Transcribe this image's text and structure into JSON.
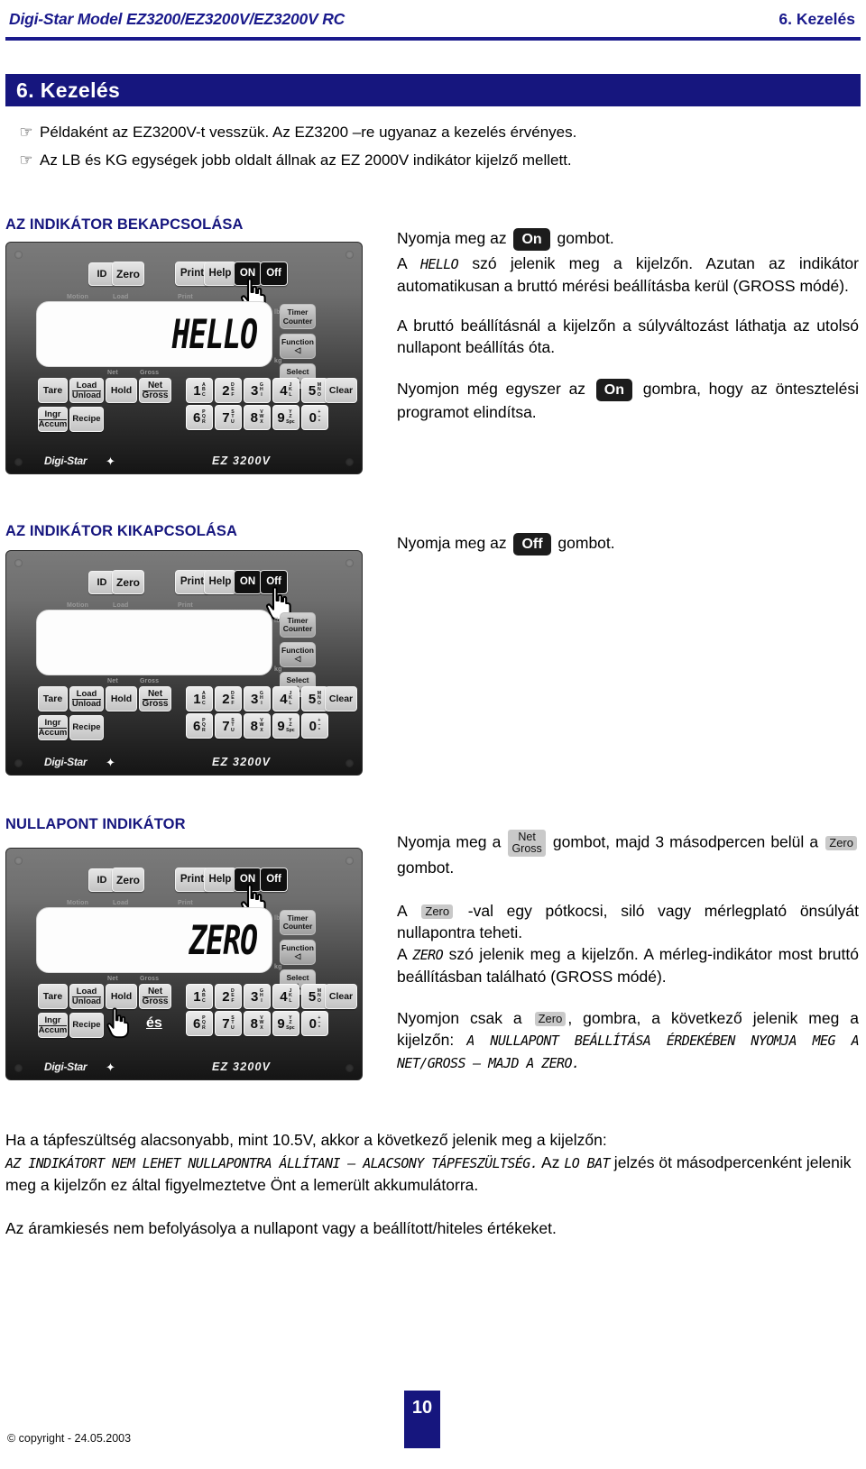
{
  "header": {
    "left": "Digi-Star Model EZ3200/EZ3200V/EZ3200V RC",
    "right": "6. Kezelés"
  },
  "chapter": {
    "title": "6. Kezelés"
  },
  "notes": [
    {
      "icon": "pointing-hand-icon",
      "text": "Példaként az EZ3200V-t vesszük. Az EZ3200 –re ugyanaz a kezelés érvényes."
    },
    {
      "icon": "pointing-hand-icon",
      "text": "Az LB és KG egységek jobb oldalt állnak az EZ 2000V indikátor kijelző mellett."
    }
  ],
  "sections": [
    {
      "id": "power-on",
      "heading": "AZ INDIKÁTOR BEKAPCSOLÁSA",
      "display_text": "HELLO",
      "paragraphs": [
        {
          "pre": "Nyomja meg az ",
          "chip": "On",
          "post": " gombot."
        },
        {
          "lcd_word": "HELLO",
          "pre": "A ",
          "post": " szó jelenik meg a kijelzőn. Azutan az indikátor automatikusan a bruttó mérési beállításba kerül (GROSS módé)."
        },
        {
          "plain": "A bruttó beállításnál a kijelzőn a súlyváltozást láthatja az utolsó nullapont beállítás óta."
        },
        {
          "pre": "Nyomjon még egyszer az ",
          "chip": "On",
          "post": " gombra, hogy az öntesztelési programot elindítsa."
        }
      ]
    },
    {
      "id": "power-off",
      "heading": "AZ INDIKÁTOR KIKAPCSOLÁSA",
      "display_text": "",
      "paragraphs": [
        {
          "pre": "Nyomja meg az ",
          "chip": "Off",
          "post": " gombot."
        }
      ]
    },
    {
      "id": "zero-point",
      "heading": "NULLAPONT INDIKÁTOR",
      "display_text": "ZERO",
      "paragraphs": [
        {
          "pre": "Nyomja meg a ",
          "chip2_top": "Net",
          "chip2_bot": "Gross",
          "mid": " gombot, majd 3 másodpercen belül a ",
          "chip": "Zero",
          "post": " gombot."
        },
        {
          "pre": "A ",
          "chip": "Zero",
          "post": " -val egy pótkocsi, siló vagy mérlegplató önsúlyát nullapontra teheti."
        },
        {
          "lcd_word": "ZERO",
          "pre": "A ",
          "post": " szó jelenik meg a kijelzőn. A mérleg-indikátor most bruttó beállításban található (GROSS módé)."
        },
        {
          "pre": "Nyomjon csak a ",
          "chip": "Zero",
          "post": ", gombra, a következő jelenik meg a kijelzőn: ",
          "lcd_tail": "A NULLAPONT BEÁLLÍTÁSA ÉRDEKÉBEN NYOMJA MEG A NET/GROSS – MAJD A ZERO."
        }
      ]
    }
  ],
  "closing": {
    "low_voltage_intro": "Ha a tápfeszültség alacsonyabb, mint 10.5V, akkor a következő jelenik meg a kijelzőn:",
    "low_voltage_lcd": "AZ INDIKÁTORT NEM LEHET NULLAPONTRA ÁLLÍTANI – ALACSONY TÁPFESZÜLTSÉG.",
    "low_voltage_mid": " Az ",
    "low_voltage_code": "LO BAT",
    "low_voltage_tail": " jelzés öt másodpercenként jelenik meg a kijelzőn ez által figyelmeztetve Önt a lemerült akkumulátorra.",
    "power_loss": "Az áramkiesés nem befolyásolya a nullapont vagy a beállított/hiteles értékeket."
  },
  "device": {
    "top_keys": [
      "ID",
      "Zero",
      "Print",
      "Help",
      "ON",
      "Off"
    ],
    "micro_labels": [
      "Motion",
      "Load",
      "Print",
      "Net",
      "Gross",
      "lb",
      "kg"
    ],
    "function_keys": [
      {
        "l1": "Tare",
        "l2": ""
      },
      {
        "l1": "Load",
        "l2": "Unload"
      },
      {
        "l1": "Hold",
        "l2": ""
      },
      {
        "l1": "Net",
        "l2": "Gross"
      },
      {
        "l1": "Ingr",
        "l2": "Accum"
      },
      {
        "l1": "Recipe",
        "l2": ""
      }
    ],
    "right_keys": [
      {
        "l1": "Timer",
        "l2": "Counter"
      },
      {
        "l1": "Function",
        "l2": "◁"
      },
      {
        "l1": "Select",
        "l2": "△"
      }
    ],
    "clear_key": "Clear",
    "numpad": [
      {
        "d": "1",
        "a": "A\nB\nC"
      },
      {
        "d": "2",
        "a": "D\nE\nF"
      },
      {
        "d": "3",
        "a": "G\nH\nI"
      },
      {
        "d": "4",
        "a": "J\nK\nL"
      },
      {
        "d": "5",
        "a": "M\nN\nO"
      },
      {
        "d": "6",
        "a": "P\nQ\nR"
      },
      {
        "d": "7",
        "a": "S\nT\nU"
      },
      {
        "d": "8",
        "a": "V\nW\nX"
      },
      {
        "d": "9",
        "a": "Y\nZ\nSpace"
      },
      {
        "d": "0",
        "a": "+\n–\n*"
      }
    ],
    "brand": "Digi-Star",
    "model": "EZ 3200V",
    "es_label": "és"
  },
  "footer": {
    "page_number": "10",
    "copyright": "© copyright - 24.05.2003"
  },
  "colors": {
    "brand_blue": "#16167e",
    "text_black": "#000000",
    "chip_dark": "#1c1c1c",
    "chip_grey": "#c9c9c9"
  }
}
